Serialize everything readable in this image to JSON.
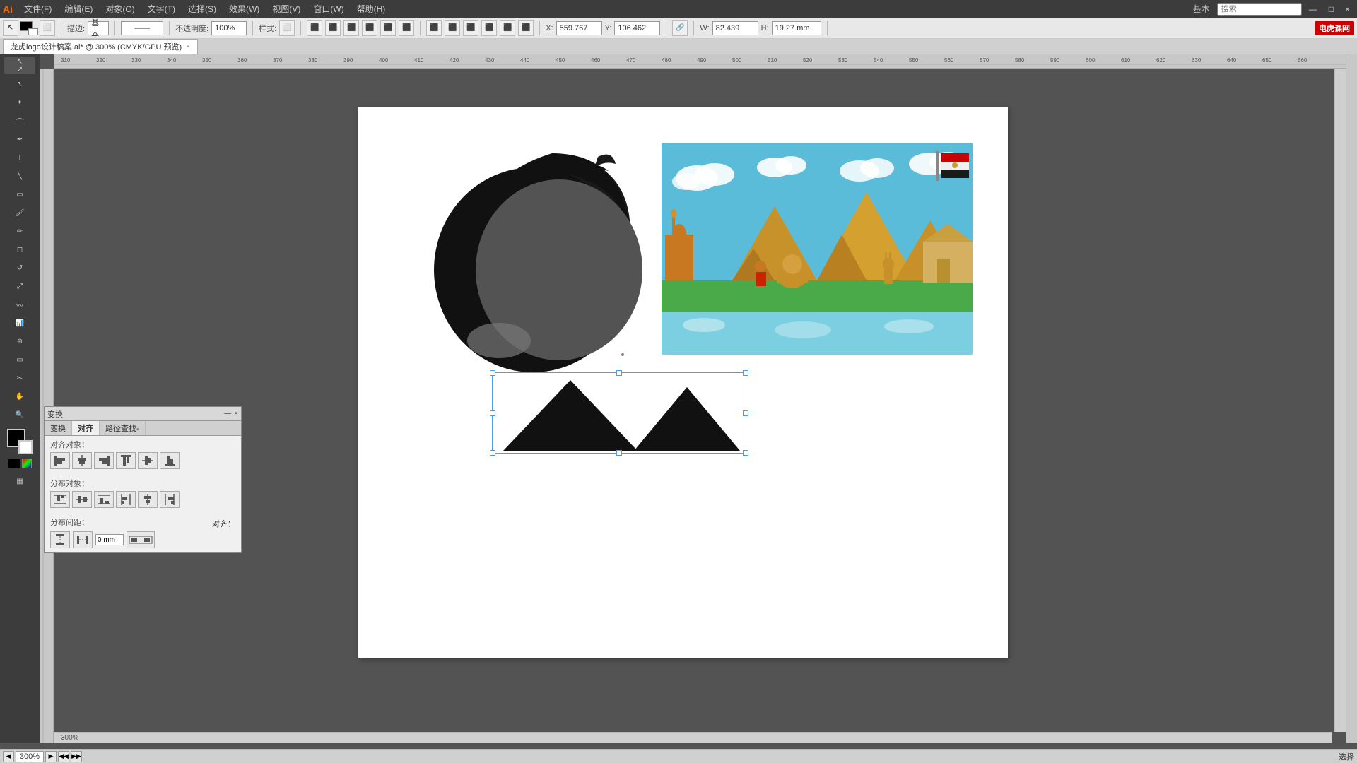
{
  "app": {
    "logo": "Ai",
    "title": "龙虎logo设计稿案.ai* @ 300% (CMYK/GPU 预览)"
  },
  "menu": {
    "items": [
      "文件(F)",
      "编辑(E)",
      "对象(O)",
      "文字(T)",
      "选择(S)",
      "效果(W)",
      "视图(V)",
      "窗口(W)",
      "帮助(H)"
    ],
    "right_label": "基本",
    "search_placeholder": "搜索"
  },
  "toolbar": {
    "fill_label": "描边:",
    "stroke_label": "描边:",
    "opacity_label": "不透明度:",
    "opacity_value": "100%",
    "style_label": "样式:",
    "x_label": "X:",
    "x_value": "559.767",
    "y_label": "Y:",
    "y_value": "106.462",
    "w_label": "W:",
    "w_value": "82.439",
    "h_label": "H:",
    "h_value": "19.27 mm"
  },
  "tab": {
    "label": "龙虎logo设计稿案.ai* @ 300% (CMYK/GPU 预览)",
    "close": "×"
  },
  "canvas": {
    "zoom": "300%"
  },
  "align_panel": {
    "title": "变换",
    "tabs": [
      "变换",
      "对齐",
      "路径查找器"
    ],
    "active_tab": "对齐",
    "align_objects_label": "对齐对象：",
    "distribute_objects_label": "分布对象：",
    "distribute_spacing_label": "分布间距：",
    "align_label": "对齐：",
    "sub_panel_titles": [
      "变换",
      "对齐",
      "路径查找-"
    ],
    "spacing_value": "0 mm",
    "close_btn": "×",
    "collapse_btn": "—"
  },
  "bottom": {
    "zoom_value": "300%",
    "status": "选择"
  },
  "colors": {
    "canvas_bg": "#535353",
    "white_canvas": "#ffffff",
    "crescent_dark": "#1a1a1a",
    "crescent_light": "#888888",
    "selection_border": "#4a9fe8",
    "ruler_bg": "#c0c0c0",
    "toolbar_bg": "#e8e8e8",
    "panel_bg": "#f0f0f0"
  }
}
